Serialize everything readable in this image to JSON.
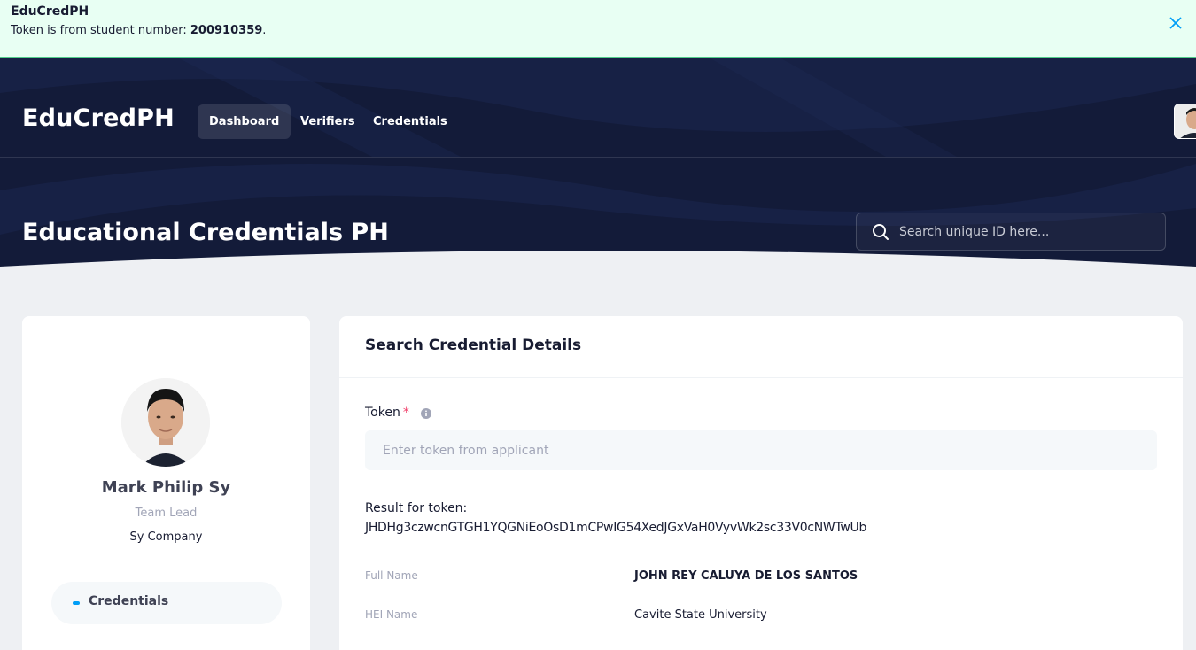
{
  "toast": {
    "title": "EduCredPH",
    "message_prefix": "Token is from student number: ",
    "student_number": "200910359",
    "message_suffix": "."
  },
  "header": {
    "brand": "EduCredPH",
    "nav": [
      "Dashboard",
      "Verifiers",
      "Credentials"
    ],
    "active_nav": "Dashboard"
  },
  "hero": {
    "page_title": "Educational Credentials PH",
    "search_placeholder": "Search unique ID here..."
  },
  "profile": {
    "name": "Mark Philip Sy",
    "role": "Team Lead",
    "company": "Sy Company",
    "menu_item": "Credentials"
  },
  "main": {
    "card_title": "Search Credential Details",
    "token_label": "Token",
    "required_mark": "*",
    "token_placeholder": "Enter token from applicant",
    "result_label": "Result for token:",
    "result_token": "JHDHg3czwcnGTGH1YQGNiEoOsD1mCPwIG54XedJGxVaH0VyvWk2sc33V0cNWTwUb",
    "details": [
      {
        "label": "Full Name",
        "value": "JOHN REY CALUYA DE LOS SANTOS"
      },
      {
        "label": "HEI Name",
        "value": "Cavite State University"
      }
    ]
  },
  "colors": {
    "toast_bg": "#e8fff3",
    "hero_bg": "#131b39",
    "accent": "#009ef7",
    "required": "#f1416c"
  }
}
